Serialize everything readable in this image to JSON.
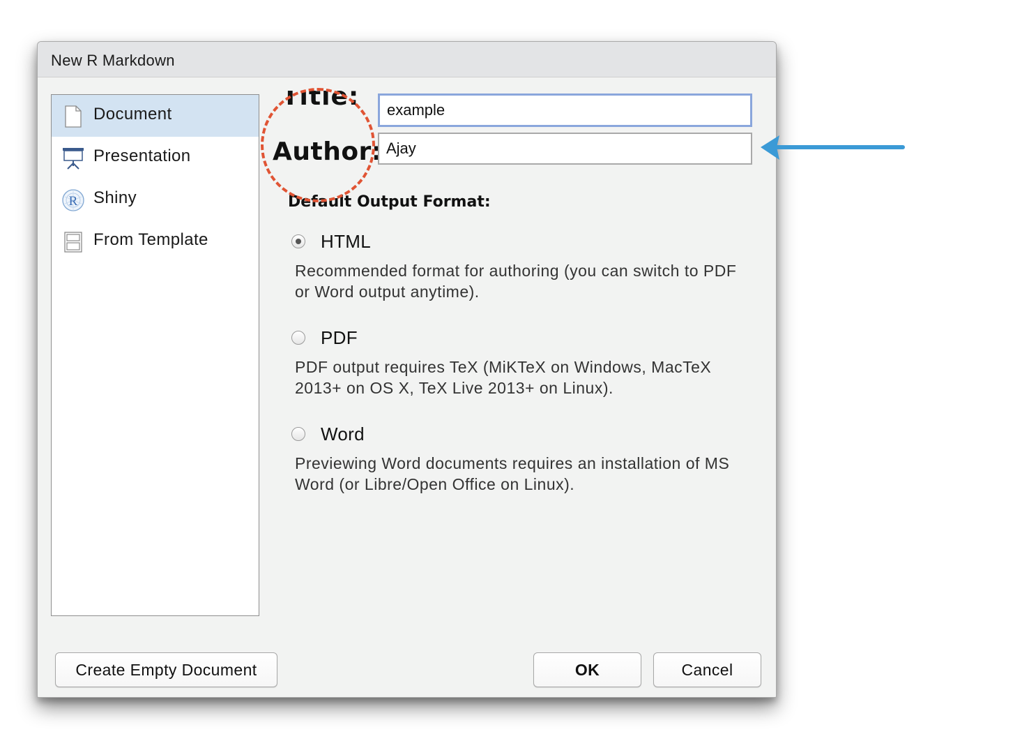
{
  "dialog": {
    "title": "New R Markdown"
  },
  "sidebar": {
    "items": [
      {
        "label": "Document",
        "icon": "document-icon",
        "selected": true
      },
      {
        "label": "Presentation",
        "icon": "presentation-icon",
        "selected": false
      },
      {
        "label": "Shiny",
        "icon": "shiny-r-icon",
        "selected": false
      },
      {
        "label": "From Template",
        "icon": "template-icon",
        "selected": false
      }
    ]
  },
  "form": {
    "title_label": "Title:",
    "title_value": "example",
    "author_label": "Author:",
    "author_value": "Ajay",
    "output_section": "Default Output Format:",
    "selected_format": "HTML",
    "options": [
      {
        "label": "HTML",
        "description": "Recommended format for authoring (you can switch to PDF or Word output anytime)."
      },
      {
        "label": "PDF",
        "description": "PDF output requires TeX (MiKTeX on Windows, MacTeX 2013+ on OS X, TeX Live 2013+ on Linux)."
      },
      {
        "label": "Word",
        "description": "Previewing Word documents requires an installation of MS Word (or Libre/Open Office on Linux)."
      }
    ]
  },
  "buttons": {
    "create_empty": "Create Empty Document",
    "ok": "OK",
    "cancel": "Cancel"
  },
  "annotations": {
    "circle_color": "#e05434",
    "arrow_color": "#3b9ad6"
  },
  "colors": {
    "selected_item_bg": "#d3e3f2",
    "focused_input_border": "#8aa6dc",
    "dialog_bg": "#f2f3f2"
  }
}
